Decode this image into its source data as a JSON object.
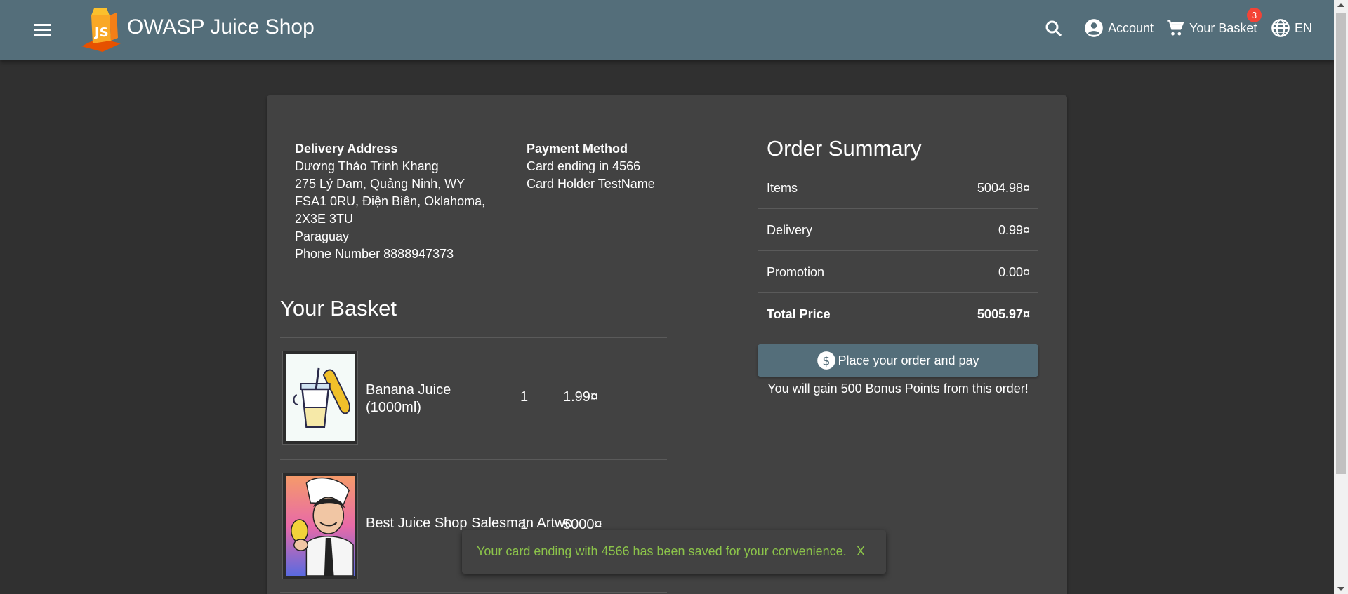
{
  "header": {
    "app_title": "OWASP Juice Shop",
    "account_label": "Account",
    "basket_label": "Your Basket",
    "basket_count": "3",
    "language_label": "EN",
    "color": "#546e7a"
  },
  "delivery": {
    "heading": "Delivery Address",
    "name": "Dương Thảo Trinh Khang",
    "line1": "275 Lý Dam, Quảng Ninh, WY",
    "line2": "FSA1 0RU, Điện Biên, Oklahoma,",
    "line3": "2X3E 3TU",
    "country": "Paraguay",
    "phone": "Phone Number 8888947373"
  },
  "payment": {
    "heading": "Payment Method",
    "card": "Card ending in 4566",
    "holder": "Card Holder TestName"
  },
  "basket": {
    "title": "Your Basket",
    "items": [
      {
        "name": "Banana Juice (1000ml)",
        "quantity": "1",
        "price": "1.99¤",
        "icon": "banana-juice-image"
      },
      {
        "name": "Best Juice Shop Salesman Artwo",
        "quantity": "1",
        "price": "5000¤",
        "icon": "salesman-artwork-image"
      }
    ]
  },
  "summary": {
    "title": "Order Summary",
    "rows": [
      {
        "label": "Items",
        "value": "5004.98¤"
      },
      {
        "label": "Delivery",
        "value": "0.99¤"
      },
      {
        "label": "Promotion",
        "value": "0.00¤"
      },
      {
        "label": "Total Price",
        "value": "5005.97¤"
      }
    ],
    "pay_button": "Place your order and pay",
    "bonus_text": "You will gain 500 Bonus Points from this order!"
  },
  "snackbar": {
    "message": "Your card ending with 4566 has been saved for your convenience.",
    "close": "X",
    "color": "#8bc34a"
  }
}
